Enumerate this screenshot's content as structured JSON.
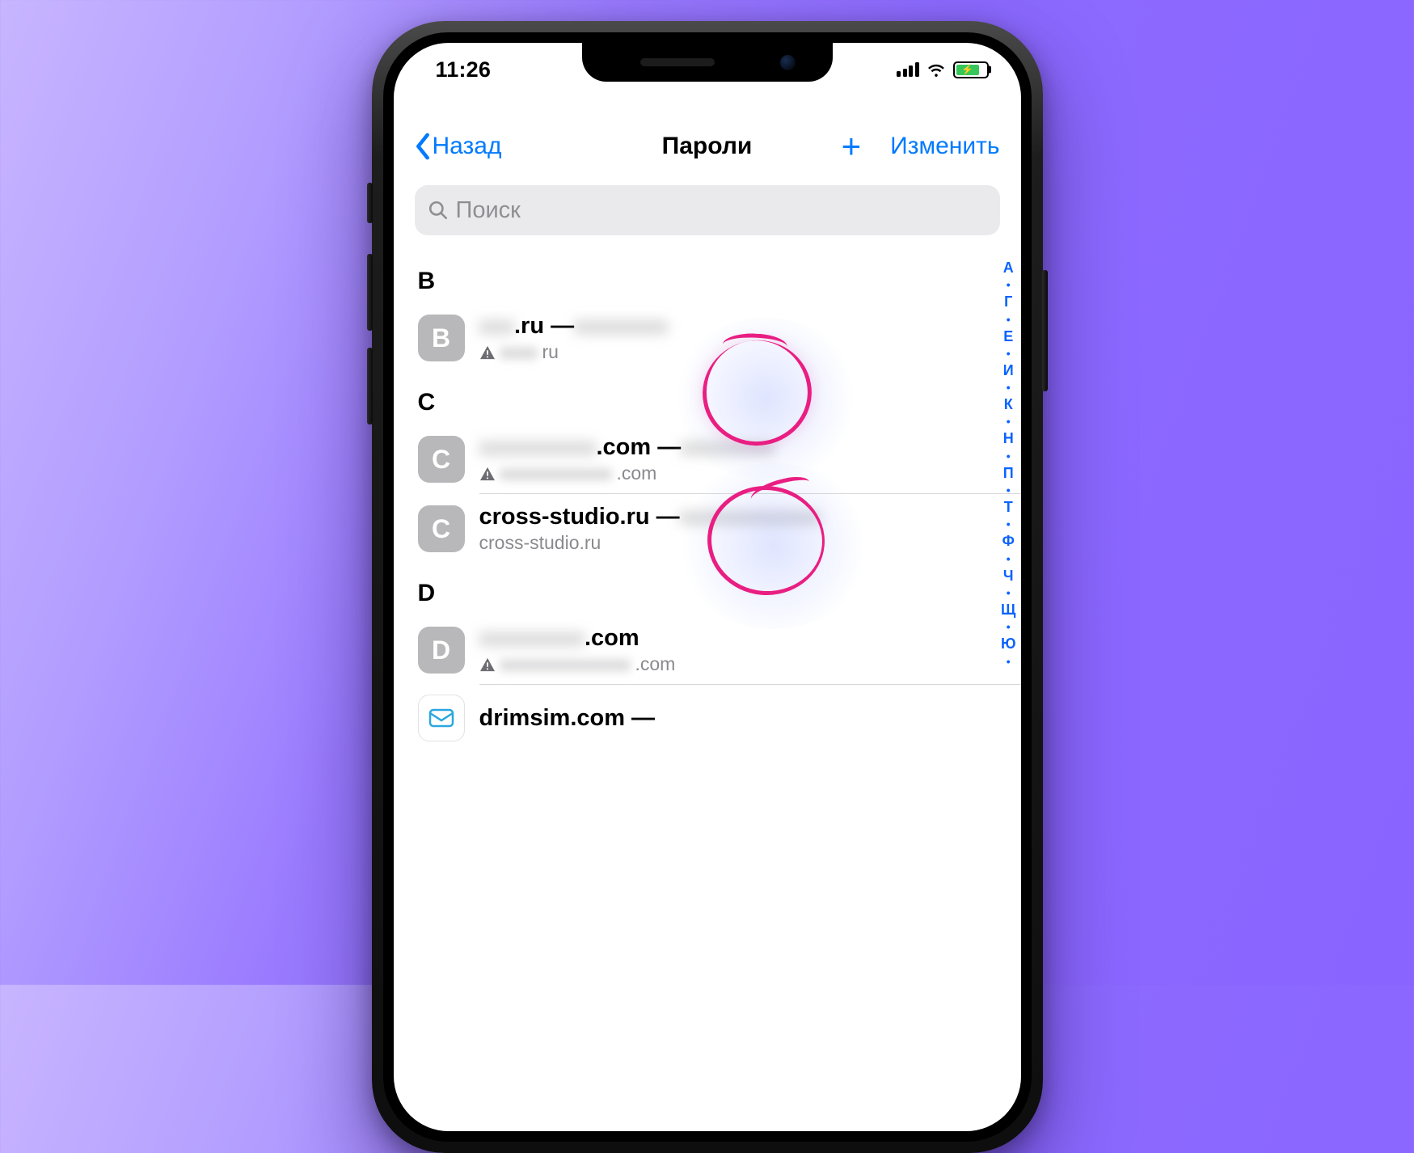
{
  "status_bar": {
    "time": "11:26"
  },
  "nav": {
    "back_label": "Назад",
    "title": "Пароли",
    "edit_label": "Изменить"
  },
  "search": {
    "placeholder": "Поиск"
  },
  "index_letters": [
    "А",
    "•",
    "Г",
    "•",
    "Е",
    "•",
    "И",
    "•",
    "К",
    "•",
    "Н",
    "•",
    "П",
    "•",
    "Т",
    "•",
    "Ф",
    "•",
    "Ч",
    "•",
    "Щ",
    "•",
    "Ю",
    "•"
  ],
  "sections": [
    {
      "letter": "B",
      "rows": [
        {
          "favicon": "B",
          "title_visible": ".ru — ",
          "title_blur_pre": "xxx",
          "title_blur_post": "xxxxxxxx",
          "sub_warning": true,
          "sub_blur": "xxxx",
          "sub_tail": "ru"
        }
      ]
    },
    {
      "letter": "C",
      "rows": [
        {
          "favicon": "C",
          "title_visible": ".com — ",
          "title_blur_pre": "xxxxxxxxxx",
          "title_blur_post": "xxxxxxxx",
          "sub_warning": true,
          "sub_blur": "xxxxxxxxxxxx",
          "sub_tail": ".com"
        },
        {
          "favicon": "C",
          "title_full": "cross-studio.ru — ",
          "title_blur_post": "xxxxxxxxxxxx",
          "sub_plain": "cross-studio.ru"
        }
      ]
    },
    {
      "letter": "D",
      "rows": [
        {
          "favicon": "D",
          "title_visible": ".com",
          "title_blur_pre": "xxxxxxxxx",
          "sub_warning": true,
          "sub_blur": "xxxxxxxxxxxxxx",
          "sub_tail": ".com"
        },
        {
          "favicon_logo": true,
          "title_full": "drimsim.com — ",
          "title_blur_post": ""
        }
      ]
    }
  ]
}
